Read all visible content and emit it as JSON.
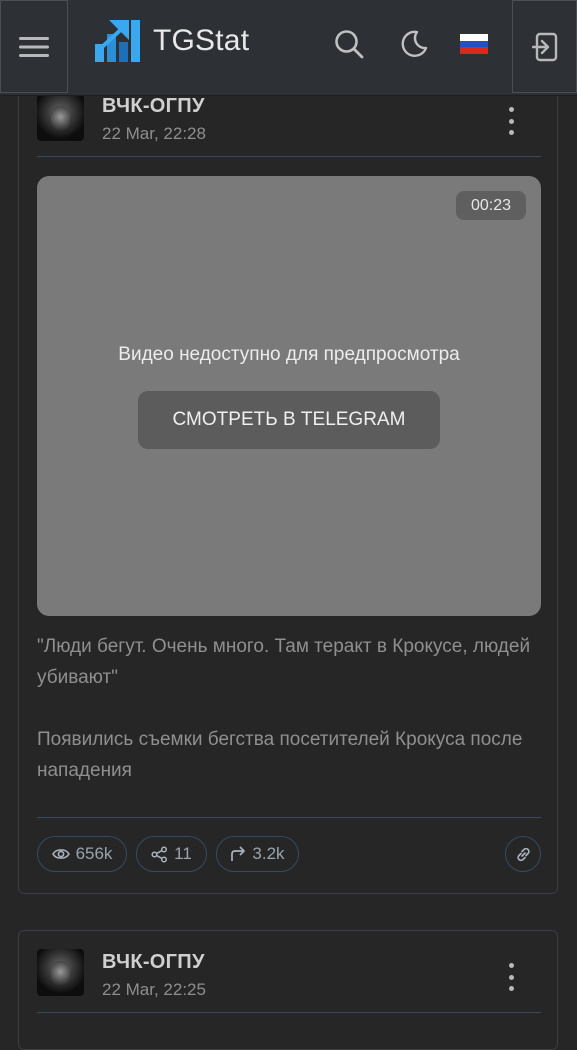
{
  "header": {
    "brand": "TGStat",
    "flag_colors": [
      "#ffffff",
      "#1f52c4",
      "#d52b1e"
    ],
    "brand_colors": {
      "logo_light": "#3aa8f0",
      "logo_dark": "#1e6fb8",
      "bg": "#2d3035"
    }
  },
  "posts": [
    {
      "channel": "ВЧК-ОГПУ",
      "date": "22 Mar, 22:28",
      "video": {
        "duration": "00:23",
        "unavailable_text": "Видео недоступно для предпросмотра",
        "button_label": "СМОТРЕТЬ В TELEGRAM"
      },
      "text_paragraph_1": "\"Люди бегут. Очень много. Там теракт в Крокусе, людей убивают\"",
      "text_paragraph_2": "Появились съемки бегства посетителей Крокуса после нападения",
      "stats": {
        "views": "656k",
        "shares": "11",
        "forwards": "3.2k"
      }
    },
    {
      "channel": "ВЧК-ОГПУ",
      "date": "22 Mar, 22:25"
    }
  ]
}
